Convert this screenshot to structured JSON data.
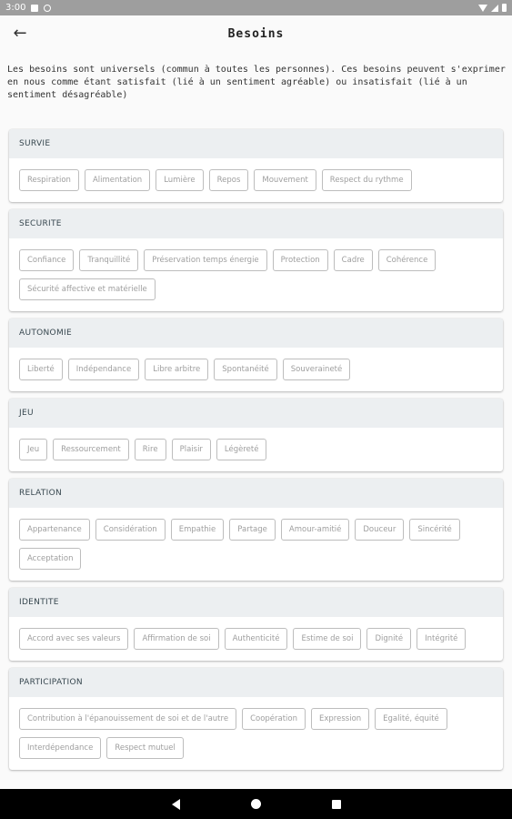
{
  "status_bar": {
    "time": "3:00"
  },
  "app_bar": {
    "title": "Besoins",
    "back_icon": "←"
  },
  "intro": "Les besoins sont universels (commun à toutes les personnes). Ces besoins peuvent s'exprimer en nous comme étant satisfait (lié à un sentiment agréable) ou insatisfait (lié à un sentiment désagréable)",
  "sections": [
    {
      "title": "SURVIE",
      "items": [
        "Respiration",
        "Alimentation",
        "Lumière",
        "Repos",
        "Mouvement",
        "Respect du rythme"
      ]
    },
    {
      "title": "SECURITE",
      "items": [
        "Confiance",
        "Tranquillité",
        "Préservation temps énergie",
        "Protection",
        "Cadre",
        "Cohérence",
        "Sécurité affective et matérielle"
      ]
    },
    {
      "title": "AUTONOMIE",
      "items": [
        "Liberté",
        "Indépendance",
        "Libre arbitre",
        "Spontanéité",
        "Souveraineté"
      ]
    },
    {
      "title": "JEU",
      "items": [
        "Jeu",
        "Ressourcement",
        "Rire",
        "Plaisir",
        "Légèreté"
      ]
    },
    {
      "title": "RELATION",
      "items": [
        "Appartenance",
        "Considération",
        "Empathie",
        "Partage",
        "Amour-amitié",
        "Douceur",
        "Sincérité",
        "Acceptation"
      ]
    },
    {
      "title": "IDENTITE",
      "items": [
        "Accord avec ses valeurs",
        "Affirmation de soi",
        "Authenticité",
        "Estime de soi",
        "Dignité",
        "Intégrité"
      ]
    },
    {
      "title": "PARTICIPATION",
      "items": [
        "Contribution à l'épanouissement de soi et de l'autre",
        "Coopération",
        "Expression",
        "Egalité, équité",
        "Interdépendance",
        "Respect mutuel"
      ]
    }
  ]
}
